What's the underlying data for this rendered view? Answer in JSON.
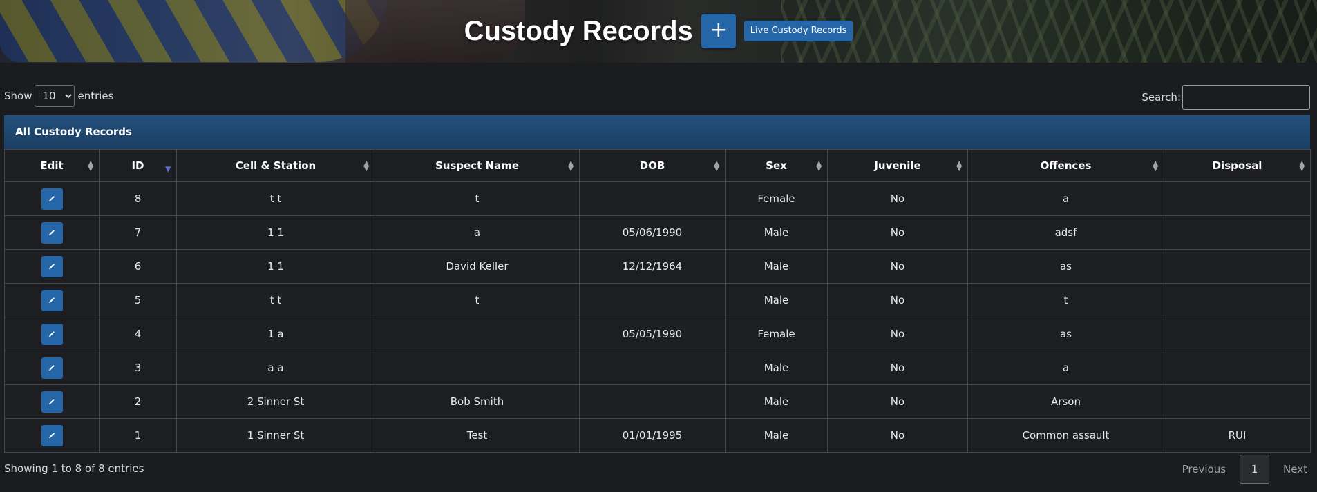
{
  "header": {
    "title": "Custody Records",
    "add_label": "+",
    "live_label": "Live Custody Records"
  },
  "controls": {
    "show_label": "Show",
    "entries_label": "entries",
    "length_value": "10",
    "length_options": [
      "10"
    ],
    "search_label": "Search:",
    "search_value": ""
  },
  "panel": {
    "title": "All Custody Records"
  },
  "table": {
    "columns": [
      "Edit",
      "ID",
      "Cell & Station",
      "Suspect Name",
      "DOB",
      "Sex",
      "Juvenile",
      "Offences",
      "Disposal"
    ],
    "sorted_column": "ID",
    "rows": [
      {
        "id": "8",
        "cell": "t t",
        "name": "t",
        "dob": "",
        "sex": "Female",
        "juvenile": "No",
        "offences": "a",
        "disposal": ""
      },
      {
        "id": "7",
        "cell": "1 1",
        "name": "a",
        "dob": "05/06/1990",
        "sex": "Male",
        "juvenile": "No",
        "offences": "adsf",
        "disposal": ""
      },
      {
        "id": "6",
        "cell": "1 1",
        "name": "David Keller",
        "dob": "12/12/1964",
        "sex": "Male",
        "juvenile": "No",
        "offences": "as",
        "disposal": ""
      },
      {
        "id": "5",
        "cell": "t t",
        "name": "t",
        "dob": "",
        "sex": "Male",
        "juvenile": "No",
        "offences": "t",
        "disposal": ""
      },
      {
        "id": "4",
        "cell": "1 a",
        "name": "",
        "dob": "05/05/1990",
        "sex": "Female",
        "juvenile": "No",
        "offences": "as",
        "disposal": ""
      },
      {
        "id": "3",
        "cell": "a a",
        "name": "",
        "dob": "",
        "sex": "Male",
        "juvenile": "No",
        "offences": "a",
        "disposal": ""
      },
      {
        "id": "2",
        "cell": "2 Sinner St",
        "name": "Bob Smith",
        "dob": "",
        "sex": "Male",
        "juvenile": "No",
        "offences": "Arson",
        "disposal": ""
      },
      {
        "id": "1",
        "cell": "1 Sinner St",
        "name": "Test",
        "dob": "01/01/1995",
        "sex": "Male",
        "juvenile": "No",
        "offences": "Common assault",
        "disposal": "RUI"
      }
    ]
  },
  "footer": {
    "info": "Showing 1 to 8 of 8 entries",
    "previous_label": "Previous",
    "current_page": "1",
    "next_label": "Next"
  },
  "icons": {
    "edit": "pencil-icon",
    "sort": "sort-arrows-icon"
  },
  "colors": {
    "accent": "#2566a8",
    "panel_header": "#1f4a74",
    "background": "#1a1c1f"
  }
}
